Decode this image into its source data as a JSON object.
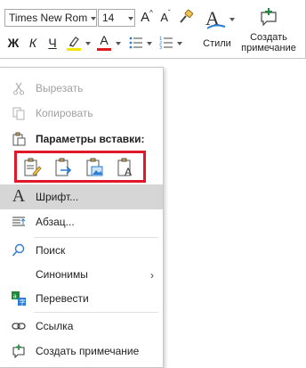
{
  "toolbar": {
    "font_name": "Times New Rom",
    "font_size": "14",
    "grow_font": "A",
    "shrink_font": "A",
    "bold": "Ж",
    "italic": "К",
    "underline": "Ч",
    "font_color_letter": "A",
    "styles_label": "Стили",
    "add_comment_label_line1": "Создать",
    "add_comment_label_line2": "примечание",
    "highlight_color": "#f5e400",
    "font_color": "#e01b1b",
    "accent": "#2b7cd3",
    "comment_icon_color": "#1f8a3b"
  },
  "menu": {
    "cut": "Вырезать",
    "copy": "Копировать",
    "paste_options": "Параметры вставки:",
    "font": "Шрифт...",
    "paragraph": "Абзац...",
    "search": "Поиск",
    "synonyms": "Синонимы",
    "translate": "Перевести",
    "link": "Ссылка",
    "new_comment": "Создать примечание"
  },
  "paste_icons": [
    "paste-keep-formatting-icon",
    "paste-merge-formatting-icon",
    "paste-picture-icon",
    "paste-text-only-icon"
  ],
  "highlight_border_color": "#e0182a"
}
